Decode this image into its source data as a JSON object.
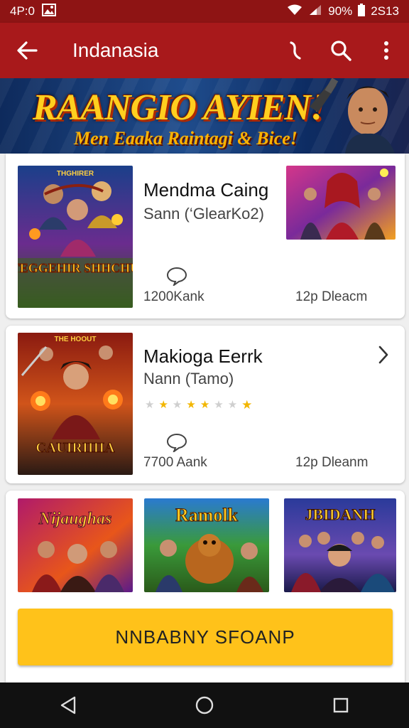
{
  "status_bar": {
    "time": "4P:0",
    "battery": "90%",
    "clock": "2S13"
  },
  "app_bar": {
    "title": "Indanasia"
  },
  "banner": {
    "headline": "RAANGIO AYIEN!",
    "subline": "Men Eaaka Raintagi & Bice!"
  },
  "cards": [
    {
      "title": "Mendma Caing",
      "subtitle": "Sann (‘GlearKo2)",
      "poster_text": "TEGGEHIR SHHCHU",
      "poster_top": "THGHIRER",
      "stat_left": "1200Kank",
      "stat_right": "12p Dleacm"
    },
    {
      "title": "Makioga Eerrk",
      "subtitle": "Nann (Tamo)",
      "poster_text": "CAUIRIIIIA",
      "poster_top": "THE HOOUT",
      "stat_left": "7700 Aank",
      "stat_right": "12p Dleanm",
      "rating": 4
    }
  ],
  "thumbs": [
    {
      "label": "Nijaughas"
    },
    {
      "label": "Ramolk"
    },
    {
      "label": "JBIDANH"
    }
  ],
  "cta": {
    "label": "NNBABNY SFOANP"
  },
  "colors": {
    "app_bar": "#a8191b",
    "status_bar": "#8e1414",
    "cta": "#ffc21a",
    "star": "#f2b600"
  }
}
